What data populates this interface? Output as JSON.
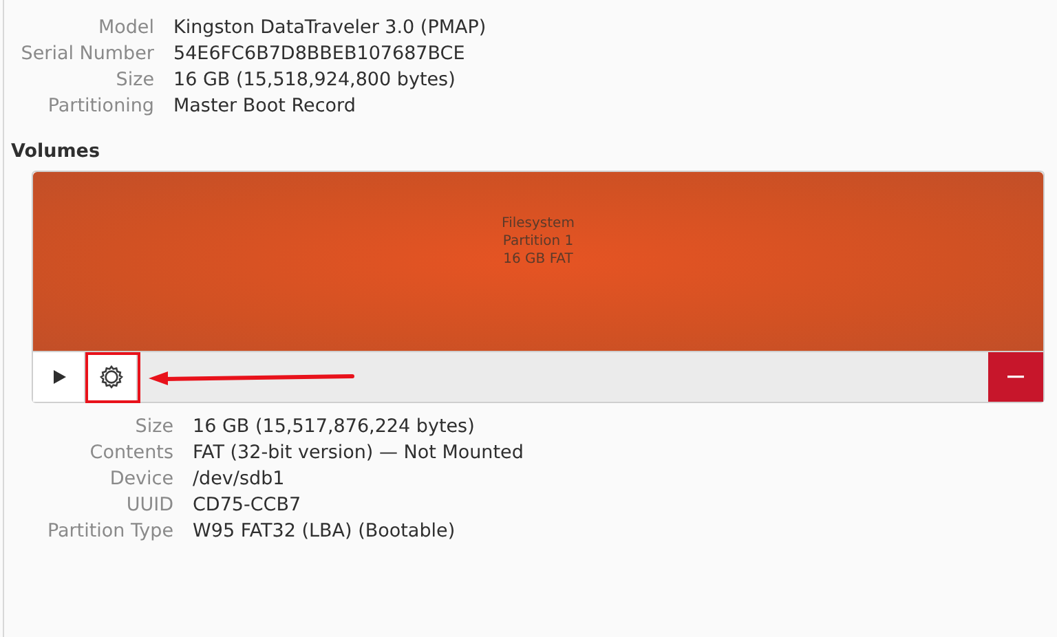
{
  "drive_info": [
    {
      "label": "Model",
      "value": "Kingston DataTraveler 3.0 (PMAP)"
    },
    {
      "label": "Serial Number",
      "value": "54E6FC6B7D8BBEB107687BCE"
    },
    {
      "label": "Size",
      "value": "16 GB (15,518,924,800 bytes)"
    },
    {
      "label": "Partitioning",
      "value": "Master Boot Record"
    }
  ],
  "volumes": {
    "heading": "Volumes",
    "partitions": [
      {
        "lines": [
          "Filesystem",
          "Partition 1",
          "16 GB FAT"
        ],
        "selected": true
      }
    ],
    "toolbar": [
      {
        "kind": "play"
      },
      {
        "kind": "settings",
        "highlighted": true
      },
      {
        "kind": "spacer"
      },
      {
        "kind": "remove"
      }
    ]
  },
  "partition_info": [
    {
      "label": "Size",
      "value": "16 GB (15,517,876,224 bytes)"
    },
    {
      "label": "Contents",
      "value": "FAT (32-bit version) — Not Mounted"
    },
    {
      "label": "Device",
      "value": "/dev/sdb1"
    },
    {
      "label": "UUID",
      "value": "CD75-CCB7"
    },
    {
      "label": "Partition Type",
      "value": "W95 FAT32 (LBA) (Bootable)"
    }
  ]
}
